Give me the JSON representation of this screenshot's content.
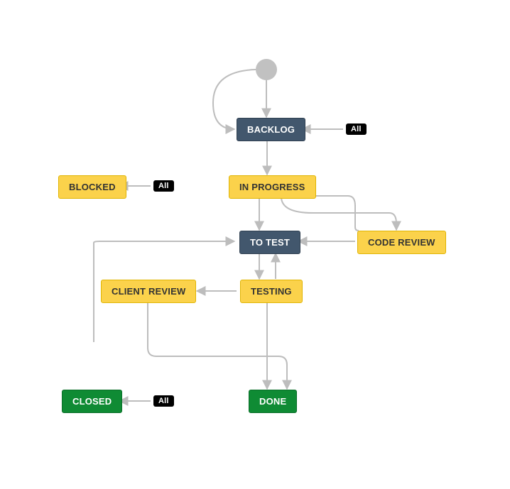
{
  "nodes": {
    "backlog": {
      "label": "BACKLOG"
    },
    "inprogress": {
      "label": "IN PROGRESS"
    },
    "blocked": {
      "label": "BLOCKED"
    },
    "totest": {
      "label": "TO TEST"
    },
    "codereview": {
      "label": "CODE REVIEW"
    },
    "testing": {
      "label": "TESTING"
    },
    "clientreview": {
      "label": "CLIENT REVIEW"
    },
    "done": {
      "label": "DONE"
    },
    "closed": {
      "label": "CLOSED"
    }
  },
  "pills": {
    "all_to_backlog": {
      "label": "All"
    },
    "all_to_blocked": {
      "label": "All"
    },
    "all_to_closed": {
      "label": "All"
    }
  },
  "colors": {
    "start": "#C1C1C1",
    "blue": "#42576D",
    "yellow": "#FBD24B",
    "green": "#0F8B34",
    "arrow": "#C7C7C7"
  }
}
